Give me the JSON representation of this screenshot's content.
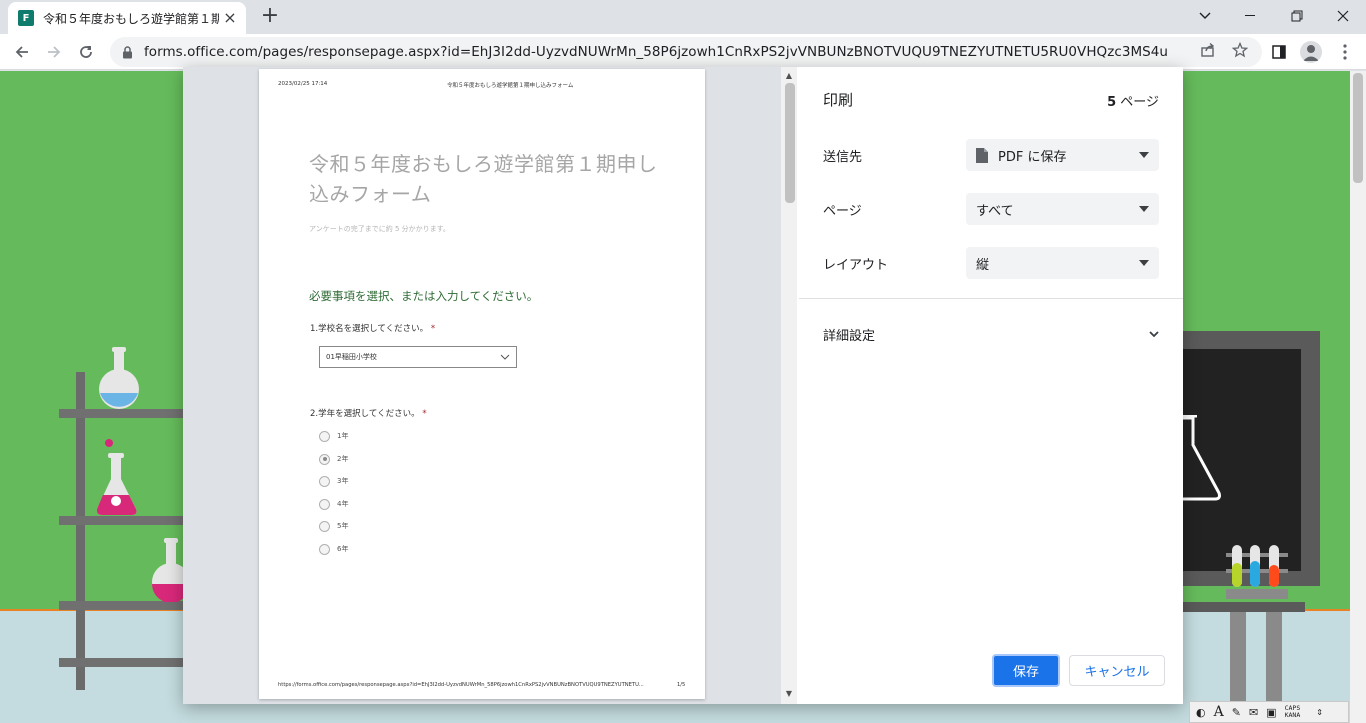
{
  "browser": {
    "tab_title": "令和５年度おもしろ遊学館第１期申し込みフォーム",
    "tab_favicon": "F",
    "url": "forms.office.com/pages/responsepage.aspx?id=EhJ3I2dd-UyzvdNUWrMn_58P6jzowh1CnRxPS2jvVNBUNzBNOTVUQU9TNEZYUTNETU5RU0VHQzc3MS4u"
  },
  "print_dialog": {
    "title": "印刷",
    "page_count": "5",
    "page_count_suffix": " ページ",
    "destination_label": "送信先",
    "destination_value": "PDF に保存",
    "pages_label": "ページ",
    "pages_value": "すべて",
    "layout_label": "レイアウト",
    "layout_value": "縦",
    "more_settings_label": "詳細設定",
    "save_button": "保存",
    "cancel_button": "キャンセル"
  },
  "preview": {
    "header_date": "2023/02/25 17:14",
    "header_title": "令和５年度おもしろ遊学館第１期申し込みフォーム",
    "form_title": "令和５年度おもしろ遊学館第１期申し込みフォーム",
    "form_subtitle": "アンケートの完了までに約 5 分かかります。",
    "section_title": "必要事項を選択、または入力してください。",
    "q1_label": "1.学校名を選択してください。",
    "q1_required": "*",
    "q1_selected": "01早稲田小学校",
    "q2_label": "2.学年を選択してください。",
    "q2_required": "*",
    "q2_options": [
      "1年",
      "2年",
      "3年",
      "4年",
      "5年",
      "6年"
    ],
    "q2_selected_index": 1,
    "footer_url": "https://forms.office.com/pages/responsepage.aspx?id=EhJ3I2dd-UyzvdNUWrMn_58P6jzowh1CnRxPS2jvVNBUNzBNOTVUQU9TNEZYUTNETU...",
    "footer_page": "1/5"
  },
  "ime": {
    "mode": "A",
    "caps": "CAPS",
    "kana": "KANA"
  },
  "colors": {
    "page_green": "#65bb5b",
    "floor_orange": "#e98125",
    "accent_blue": "#1a73e8"
  }
}
